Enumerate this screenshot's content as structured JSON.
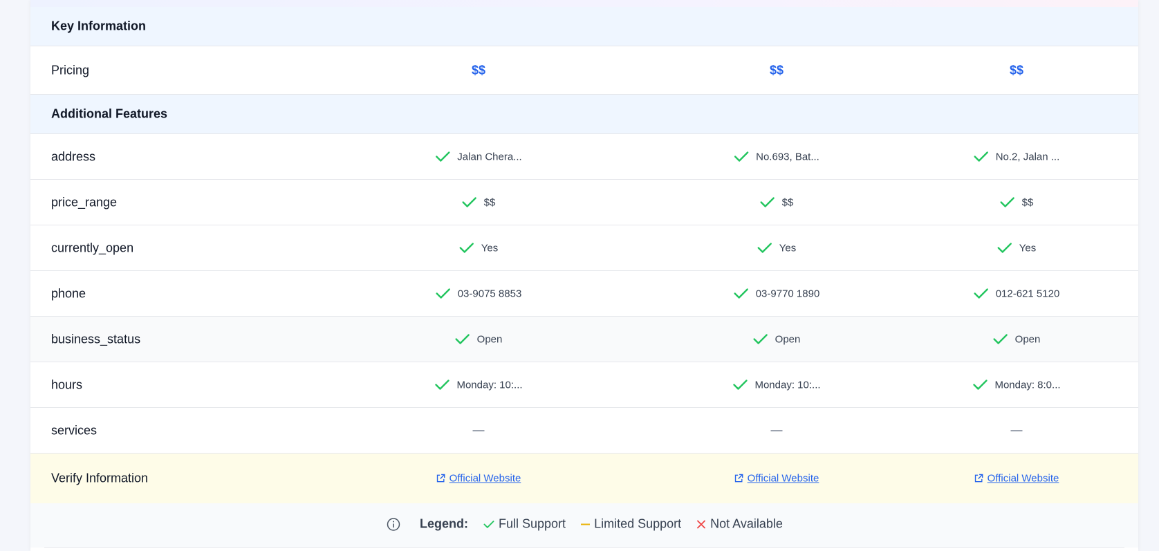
{
  "sections": {
    "key_information": "Key Information",
    "additional_features": "Additional Features"
  },
  "pricing": {
    "label": "Pricing",
    "values": [
      "$$",
      "$$",
      "$$"
    ]
  },
  "features": [
    {
      "label": "address",
      "status": "full",
      "values": [
        "Jalan Chera...",
        "No.693, Bat...",
        "No.2, Jalan ..."
      ]
    },
    {
      "label": "price_range",
      "status": "full",
      "values": [
        "$$",
        "$$",
        "$$"
      ]
    },
    {
      "label": "currently_open",
      "status": "full",
      "values": [
        "Yes",
        "Yes",
        "Yes"
      ]
    },
    {
      "label": "phone",
      "status": "full",
      "values": [
        "03-9075 8853",
        "03-9770 1890",
        "012-621 5120"
      ]
    },
    {
      "label": "business_status",
      "status": "full",
      "values": [
        "Open",
        "Open",
        "Open"
      ]
    },
    {
      "label": "hours",
      "status": "full",
      "values": [
        "Monday: 10:...",
        "Monday: 10:...",
        "Monday: 8:0..."
      ]
    },
    {
      "label": "services",
      "status": "none",
      "values": [
        "",
        "",
        ""
      ]
    }
  ],
  "verify": {
    "label": "Verify Information",
    "links": [
      "Official Website",
      "Official Website",
      "Official Website"
    ]
  },
  "legend": {
    "title": "Legend:",
    "full": "Full Support",
    "limited": "Limited Support",
    "none": "Not Available"
  },
  "colors": {
    "accent": "#2563eb",
    "check": "#22c55e",
    "limited": "#eab308",
    "not_available": "#ef4444",
    "section_bg": "#eff6ff",
    "verify_bg": "#fefce8"
  },
  "icons": {
    "check": "check-icon",
    "dash": "dash-icon",
    "external_link": "external-link-icon",
    "info": "info-icon",
    "cross": "x-icon"
  }
}
